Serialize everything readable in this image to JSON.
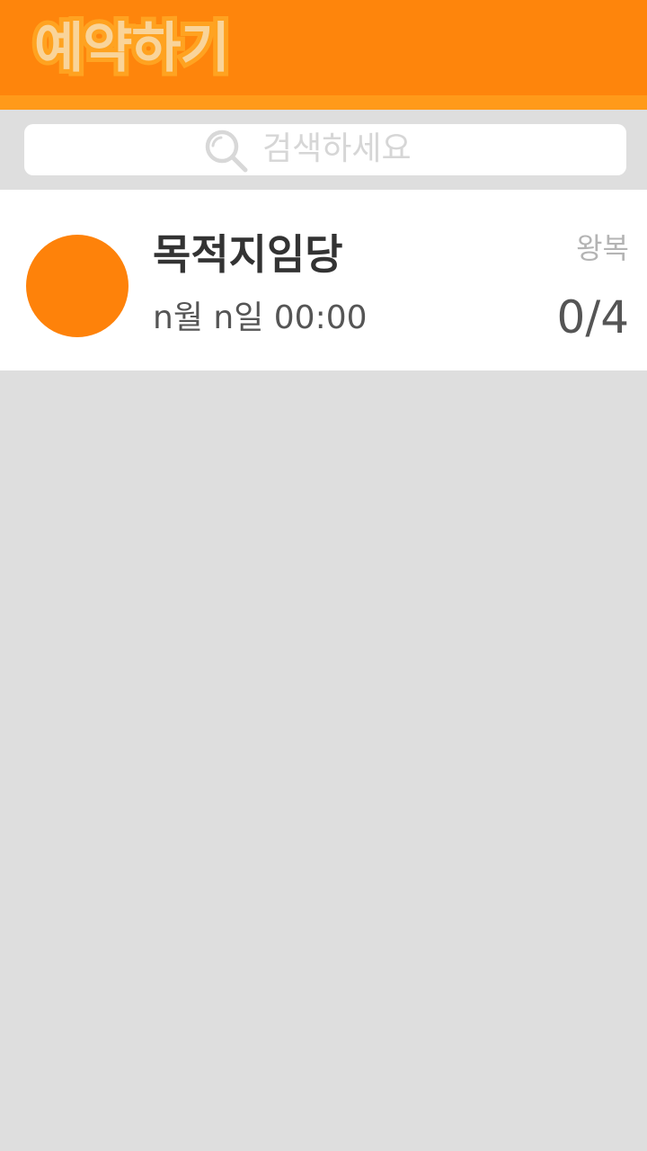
{
  "header": {
    "title": "예약하기",
    "bg_color": "#fe850c",
    "stripe_color": "#ff9a1a"
  },
  "search": {
    "placeholder": "검색하세요",
    "icon": "search-icon"
  },
  "reservations": [
    {
      "title": "목적지임당",
      "date": "n월 n일 00:00",
      "trip_type": "왕복",
      "count": "0/4",
      "avatar_color": "#fe820a"
    }
  ],
  "background_color": "#dedede"
}
